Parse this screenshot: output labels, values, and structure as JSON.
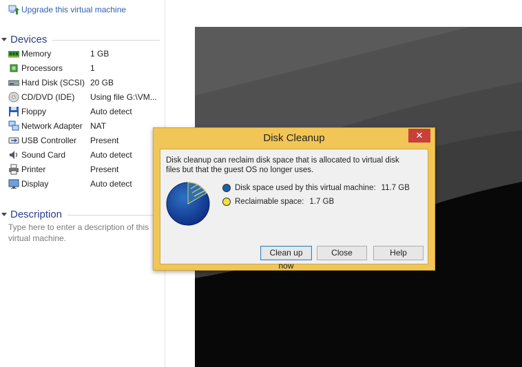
{
  "sidebar": {
    "upgrade_link": "Upgrade this virtual machine",
    "devices_title": "Devices",
    "devices": [
      {
        "name": "Memory",
        "value": "1 GB",
        "icon": "memory-icon"
      },
      {
        "name": "Processors",
        "value": "1",
        "icon": "processor-icon"
      },
      {
        "name": "Hard Disk (SCSI)",
        "value": "20 GB",
        "icon": "hard-disk-icon"
      },
      {
        "name": "CD/DVD (IDE)",
        "value": "Using file G:\\VM...",
        "icon": "cd-dvd-icon"
      },
      {
        "name": "Floppy",
        "value": "Auto detect",
        "icon": "floppy-icon"
      },
      {
        "name": "Network Adapter",
        "value": "NAT",
        "icon": "network-adapter-icon"
      },
      {
        "name": "USB Controller",
        "value": "Present",
        "icon": "usb-icon"
      },
      {
        "name": "Sound Card",
        "value": "Auto detect",
        "icon": "sound-card-icon"
      },
      {
        "name": "Printer",
        "value": "Present",
        "icon": "printer-icon"
      },
      {
        "name": "Display",
        "value": "Auto detect",
        "icon": "display-icon"
      }
    ],
    "description_title": "Description",
    "description_placeholder": "Type here to enter a description of this virtual machine."
  },
  "dialog": {
    "title": "Disk Cleanup",
    "close_glyph": "✕",
    "message": "Disk cleanup can reclaim disk space that is allocated to virtual disk files but that the guest OS no longer uses.",
    "used_label": "Disk space used by this virtual machine:",
    "used_value": "11.7 GB",
    "reclaimable_label": "Reclaimable space:",
    "reclaimable_value": "1.7 GB",
    "buttons": {
      "clean": "Clean up now",
      "close": "Close",
      "help": "Help"
    }
  },
  "colors": {
    "used": "#1a5fa8",
    "reclaimable": "#f2e23a",
    "dialog_frame": "#f1c656",
    "link": "#2b5fb4",
    "section_title": "#2b3d8a"
  }
}
